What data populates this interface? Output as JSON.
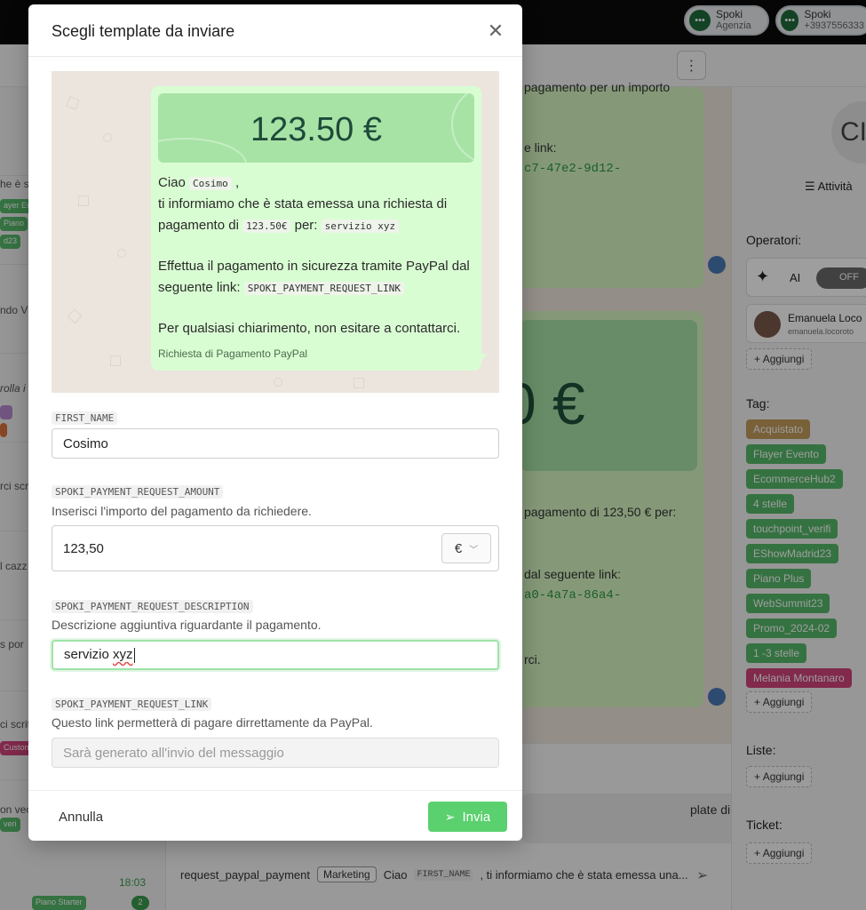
{
  "accounts": [
    {
      "name": "Spoki",
      "sub": "Agenzia"
    },
    {
      "name": "Spoki",
      "sub": "+3937556333"
    }
  ],
  "background_chat": {
    "lines": [
      "pagamento per un importo",
      "e link:",
      "pagamento di 123,50 € per:",
      "dal seguente link:",
      "rci."
    ],
    "links": [
      "c7-47e2-9d12-",
      "a0-4a7a-86a4-"
    ],
    "big_amount": "0 €"
  },
  "left_list": {
    "snippets": [
      "he è s",
      "ndo V",
      "rolla i",
      "rci scri",
      "l cazz",
      "s por",
      "ci scrit",
      "on vec",
      "18:03"
    ],
    "chips": [
      "ayer Ever",
      "Piano",
      "d23",
      "Custon",
      "veri",
      "Piano Starter"
    ],
    "badge": "2"
  },
  "composer": {
    "hint": "plate di tipo \"Richiesta",
    "template_name": "request_paypal_payment",
    "category": "Marketing",
    "preview_start": "Ciao",
    "preview_var": "FIRST_NAME",
    "preview_rest": ", ti informiamo che è stata emessa una..."
  },
  "right_panel": {
    "avatar_initials": "CI",
    "activity": "Attività",
    "operators_title": "Operatori:",
    "ai_label": "AI",
    "toggle": "OFF",
    "operator_name": "Emanuela Loco",
    "operator_email": "emanuela.locoroto",
    "add_label": "Aggiungi",
    "tag_title": "Tag:",
    "tags": [
      {
        "label": "Acquistato",
        "color": "#c29b5c"
      },
      {
        "label": "Flayer Evento",
        "color": "#56b96a"
      },
      {
        "label": "EcommerceHub2",
        "color": "#56b96a"
      },
      {
        "label": "4 stelle",
        "color": "#56b96a"
      },
      {
        "label": "touchpoint_verifi",
        "color": "#56b96a"
      },
      {
        "label": "EShowMadrid23",
        "color": "#56b96a"
      },
      {
        "label": "Piano Plus",
        "color": "#56b96a"
      },
      {
        "label": "WebSummit23",
        "color": "#56b96a"
      },
      {
        "label": "Promo_2024-02",
        "color": "#56b96a"
      },
      {
        "label": "1 -3 stelle",
        "color": "#56b96a"
      },
      {
        "label": "Melania Montanaro",
        "color": "#d0457a"
      }
    ],
    "lists_title": "Liste:",
    "ticket_title": "Ticket:"
  },
  "modal": {
    "title": "Scegli template da inviare",
    "preview": {
      "amount": "123.50 €",
      "greeting": "Ciao",
      "first_name": "Cosimo",
      "line2": "ti informiamo che è stata emessa una richiesta di",
      "line3_a": "pagamento di",
      "amount_var": "123.50€",
      "line3_b": "per:",
      "description_var": "servizio xyz",
      "line4": "Effettua il pagamento in sicurezza tramite PayPal dal",
      "line5_a": "seguente link:",
      "link_var": "SPOKI_PAYMENT_REQUEST_LINK",
      "line6": "Per qualsiasi chiarimento, non esitare a contattarci.",
      "footer": "Richiesta di Pagamento PayPal"
    },
    "fields": {
      "first_name": {
        "label": "FIRST_NAME",
        "value": "Cosimo"
      },
      "amount": {
        "label": "SPOKI_PAYMENT_REQUEST_AMOUNT",
        "description": "Inserisci l'importo del pagamento da richiedere.",
        "value": "123,50",
        "currency": "€"
      },
      "description": {
        "label": "SPOKI_PAYMENT_REQUEST_DESCRIPTION",
        "description": "Descrizione aggiuntiva riguardante il pagamento.",
        "value_a": "servizio ",
        "value_b": "xyz"
      },
      "link": {
        "label": "SPOKI_PAYMENT_REQUEST_LINK",
        "description": "Questo link permetterà di pagare dirrettamente da PayPal.",
        "placeholder": "Sarà generato all'invio del messaggio"
      }
    },
    "cancel_label": "Annulla",
    "send_label": "Invia"
  }
}
